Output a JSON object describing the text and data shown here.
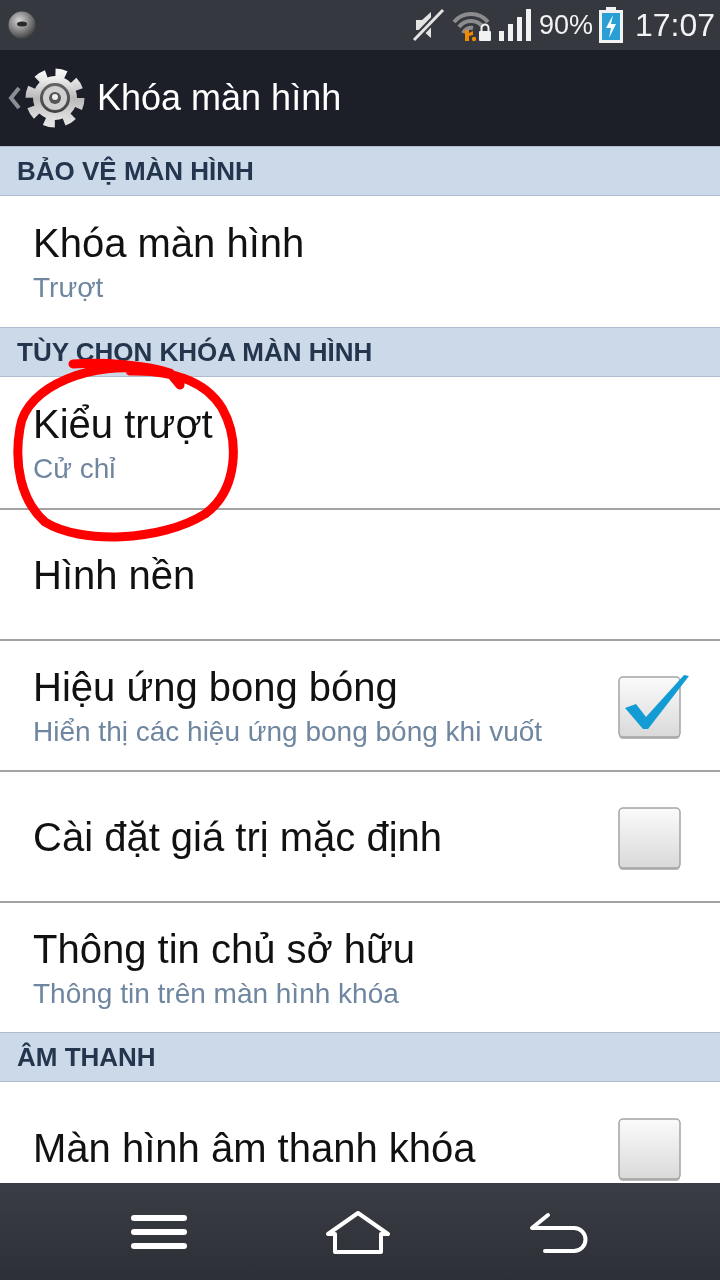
{
  "status_bar": {
    "battery": "90%",
    "time": "17:07"
  },
  "action_bar": {
    "title": "Khóa màn hình"
  },
  "sections": [
    {
      "header": "BẢO VỆ MÀN HÌNH",
      "items": [
        {
          "kind": "plain",
          "title": "Khóa màn hình",
          "summary": "Trượt"
        }
      ]
    },
    {
      "header": "TÙY CHỌN KHÓA MÀN HÌNH",
      "items": [
        {
          "kind": "plain",
          "title": "Kiểu trượt",
          "summary": "Cử chỉ"
        },
        {
          "kind": "plain",
          "title": "Hình nền"
        },
        {
          "kind": "checkbox",
          "title": "Hiệu ứng bong bóng",
          "summary": "Hiển thị các hiệu ứng bong bóng khi vuốt",
          "checked": true
        },
        {
          "kind": "checkbox",
          "title": "Cài đặt giá trị mặc định",
          "checked": false
        },
        {
          "kind": "plain",
          "title": "Thông tin chủ sở hữu",
          "summary": "Thông tin trên màn hình khóa"
        }
      ]
    },
    {
      "header": "ÂM THANH",
      "items": [
        {
          "kind": "checkbox",
          "title": "Màn hình âm thanh khóa",
          "checked": false
        }
      ]
    }
  ]
}
